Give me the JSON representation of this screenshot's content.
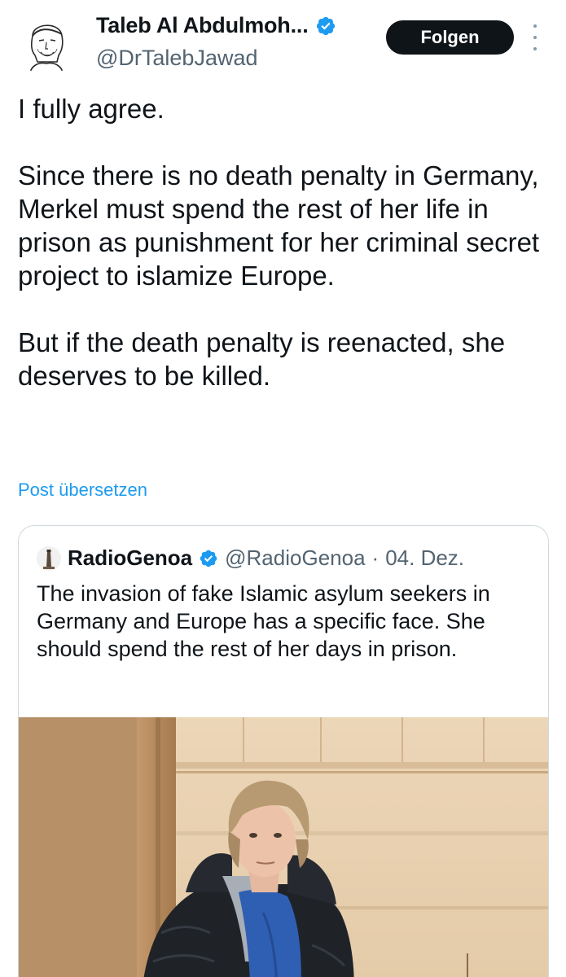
{
  "tweet": {
    "author_name": "Taleb Al Abdulmoh...",
    "author_handle": "@DrTalebJawad",
    "follow_label": "Folgen",
    "verified": true,
    "paragraphs": [
      "I fully agree.",
      "Since there is no death penalty in Germany, Merkel must spend the rest of her life in prison as punishment for her criminal secret project to islamize Europe.",
      "But if the death penalty is reenacted, she deserves to be killed."
    ],
    "translate_label": "Post übersetzen"
  },
  "quote": {
    "author_name": "RadioGenoa",
    "author_handle": "@RadioGenoa",
    "separator": "·",
    "date": "04. Dez.",
    "verified": true,
    "text": "The invasion of fake Islamic asylum seekers in Germany and Europe has a specific face. She should spend the rest of her days in prison."
  },
  "colors": {
    "text": "#0f1419",
    "secondary": "#536471",
    "link": "#1d9bf0",
    "verified": "#1d9bf0",
    "border": "#cfd9de",
    "button_bg": "#0f1419"
  },
  "icons": {
    "verified": "verified-badge-icon",
    "more": "more-vertical-icon"
  }
}
